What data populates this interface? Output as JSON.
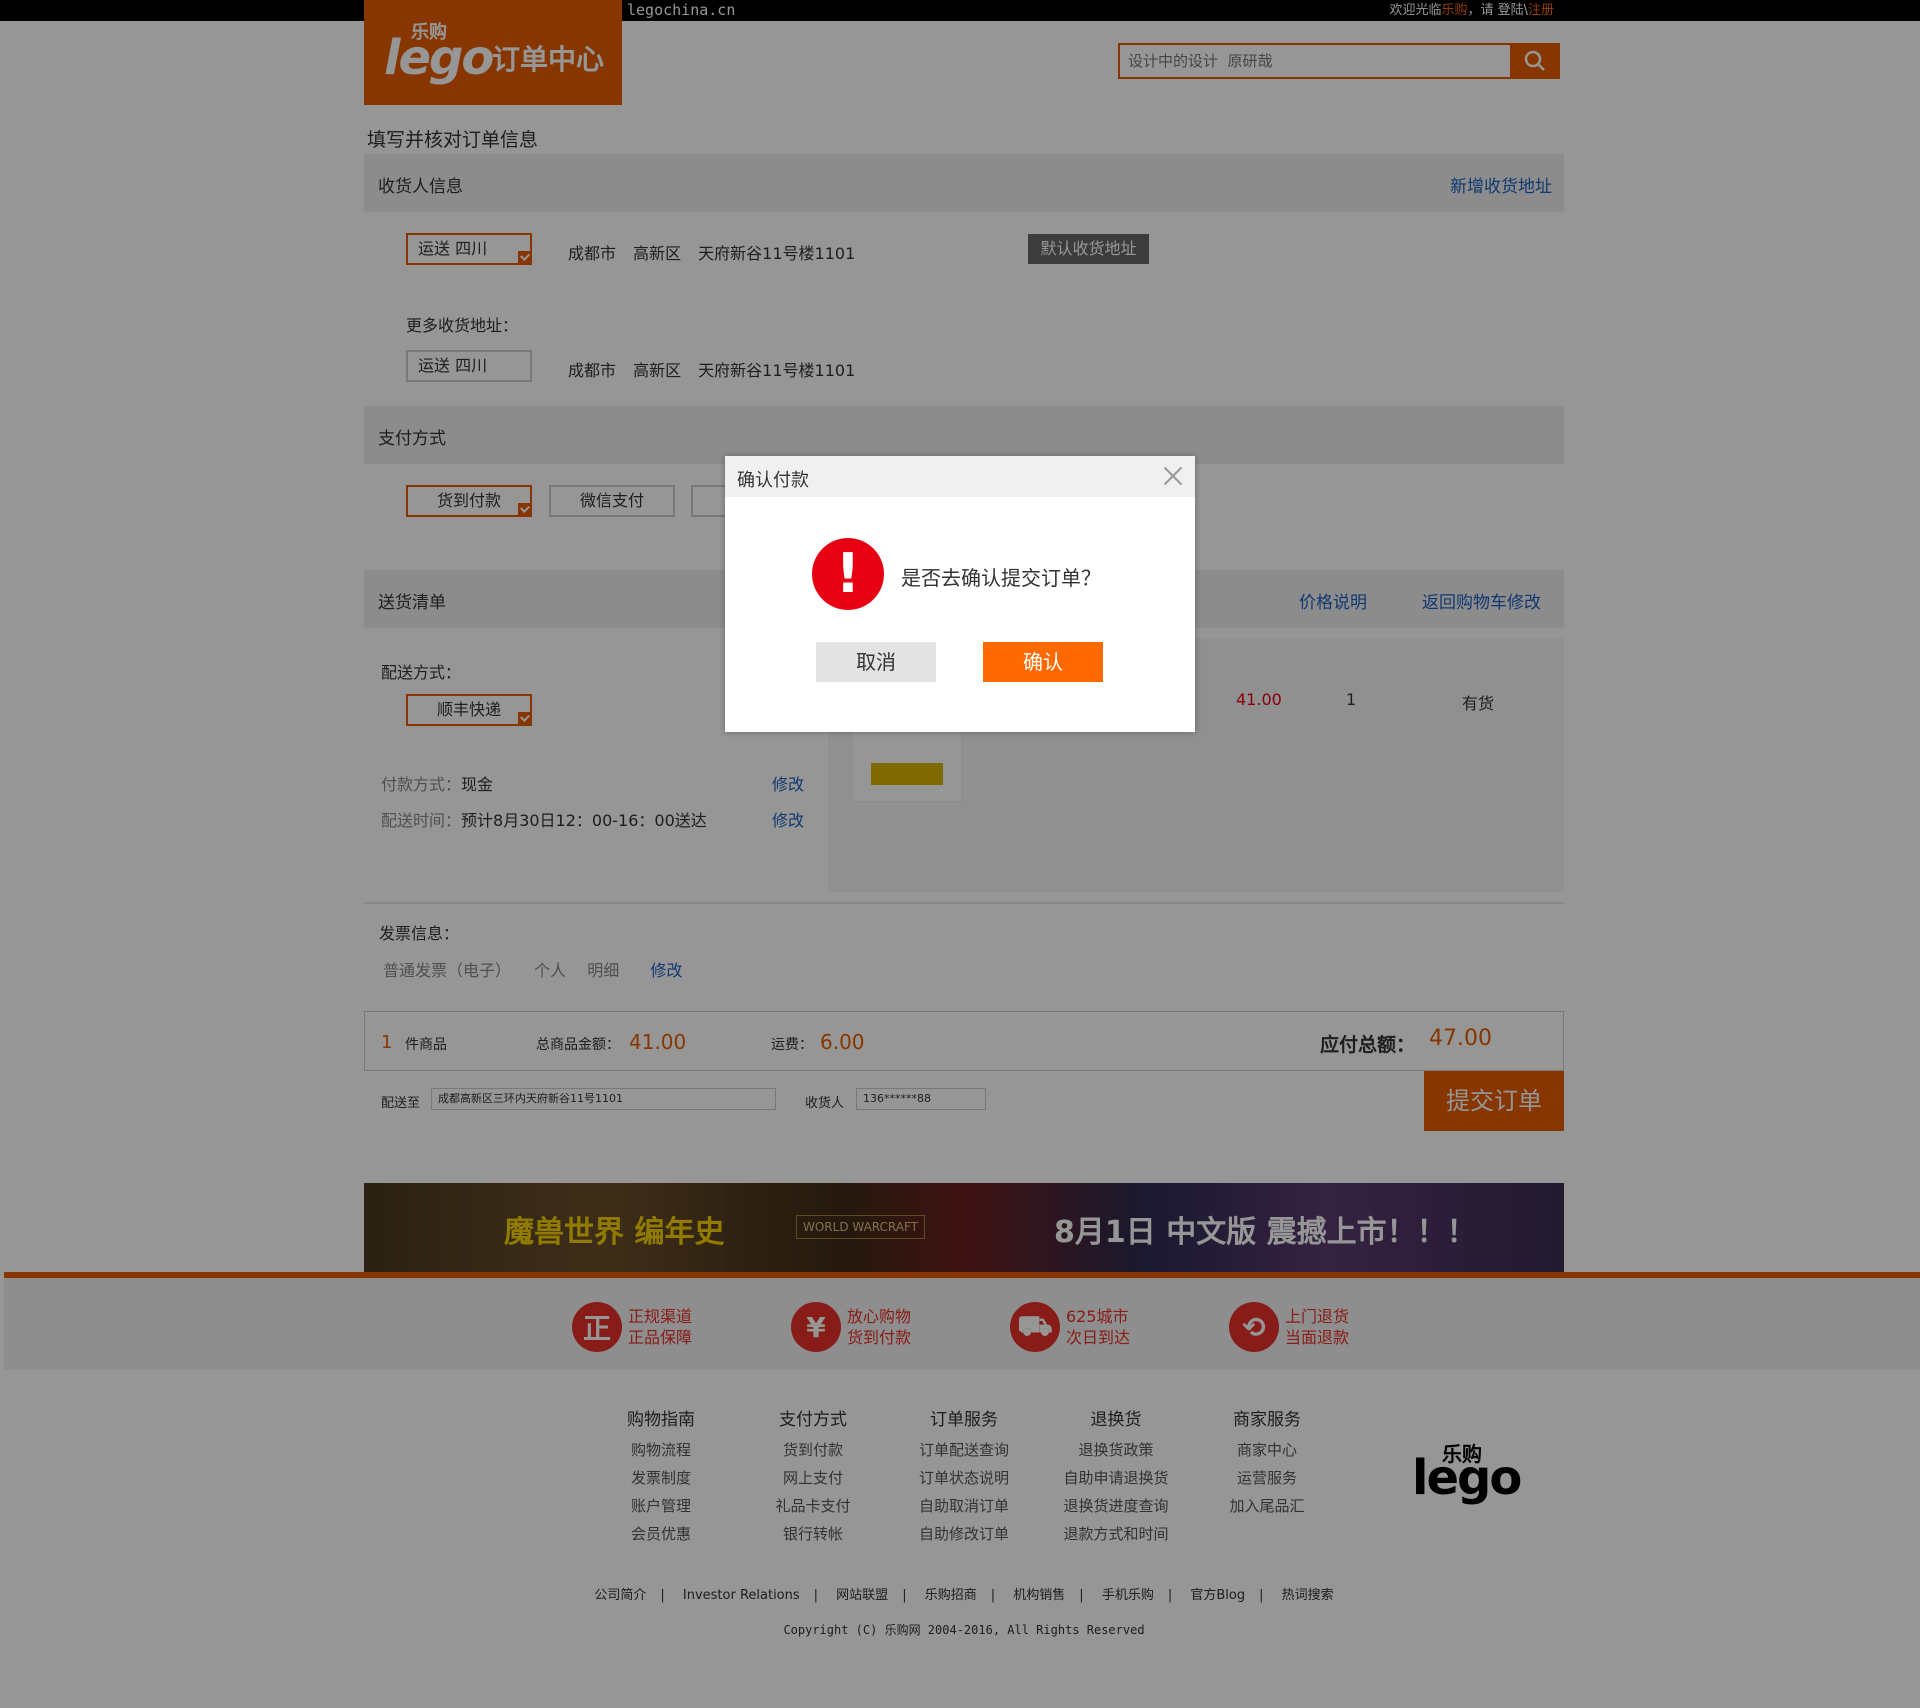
{
  "header": {
    "site_url": "legochina.cn",
    "welcome_prefix": "欢迎光临",
    "welcome_brand": "乐购",
    "welcome_mid": "，请  登陆\\",
    "register": "注册",
    "logo_small": "乐购",
    "logo_lego": "lego",
    "logo_title": "订单中心",
    "search_placeholder": "设计中的设计  原研哉"
  },
  "page_heading": "填写并核对订单信息",
  "consignee": {
    "section_title": "收货人信息",
    "add_link": "新增收货地址",
    "primary": {
      "province": "运送   四川",
      "address": "成都市  高新区  天府新谷11号楼1101"
    },
    "default_tag": "默认收货地址",
    "more_label": "更多收货地址：",
    "secondary": {
      "province": "运送   四川",
      "address": "成都市  高新区  天府新谷11号楼1101"
    }
  },
  "payment": {
    "section_title": "支付方式",
    "options": [
      "货到付款",
      "微信支付"
    ]
  },
  "delivery": {
    "section_title": "送货清单",
    "price_link": "价格说明",
    "back_link": "返回购物车修改",
    "method_label": "配送方式：",
    "method": "顺丰快递",
    "pay_label": "付款方式：",
    "pay_value": "现金",
    "time_label": "配送时间：",
    "time_value": "预计8月30日12：00-16：00送达",
    "modify": "修改",
    "item": {
      "price": "41.00",
      "qty": "1",
      "stock": "有货"
    }
  },
  "invoice": {
    "label": "发票信息：",
    "type": "普通发票（电子）",
    "person": "个人",
    "detail": "明细",
    "modify": "修改"
  },
  "summary": {
    "count": "1",
    "count_label": "件商品",
    "total_label": "总商品金额：",
    "total": "41.00",
    "freight_label": "运费：",
    "freight": "6.00",
    "payable_label": "应付总额：",
    "payable": "47.00",
    "ship_to_label": "配送至",
    "ship_to": "成都高新区三环内天府新谷11号1101",
    "receiver_label": "收货人",
    "receiver": "136******88",
    "submit": "提交订单"
  },
  "banner": {
    "left": "魔兽世界  编年史",
    "logo": "WORLD WARCRAFT",
    "right": "8月1日  中文版  震撼上市！！！"
  },
  "promos": [
    {
      "icon": "正",
      "l1": "正规渠道",
      "l2": "正品保障"
    },
    {
      "icon": "¥",
      "l1": "放心购物",
      "l2": "货到付款"
    },
    {
      "icon": "⛟",
      "l1": "625城市",
      "l2": "次日到达"
    },
    {
      "icon": "⟲",
      "l1": "上门退货",
      "l2": "当面退款"
    }
  ],
  "footer_cols": [
    {
      "title": "购物指南",
      "items": [
        "购物流程",
        "发票制度",
        "账户管理",
        "会员优惠"
      ]
    },
    {
      "title": "支付方式",
      "items": [
        "货到付款",
        "网上支付",
        "礼品卡支付",
        "银行转帐"
      ]
    },
    {
      "title": "订单服务",
      "items": [
        "订单配送查询",
        "订单状态说明",
        "自助取消订单",
        "自助修改订单"
      ]
    },
    {
      "title": "退换货",
      "items": [
        "退换货政策",
        "自助申请退换货",
        "退换货进度查询",
        "退款方式和时间"
      ]
    },
    {
      "title": "商家服务",
      "items": [
        "商家中心",
        "运营服务",
        "加入尾品汇"
      ]
    }
  ],
  "footer_logo": {
    "small": "乐购",
    "lego": "lego"
  },
  "footer_links": [
    "公司简介",
    "Investor Relations",
    "网站联盟",
    "乐购招商",
    "机构销售",
    "手机乐购",
    "官方Blog",
    "热词搜索"
  ],
  "copyright": "Copyright (C) 乐购网 2004-2016, All Rights Reserved",
  "modal": {
    "title": "确认付款",
    "message": "是否去确认提交订单？",
    "icon": "!",
    "cancel": "取消",
    "confirm": "确认"
  },
  "colors": {
    "accent": "#e65c00",
    "link": "#1e5fbf",
    "alert": "#e60012"
  }
}
